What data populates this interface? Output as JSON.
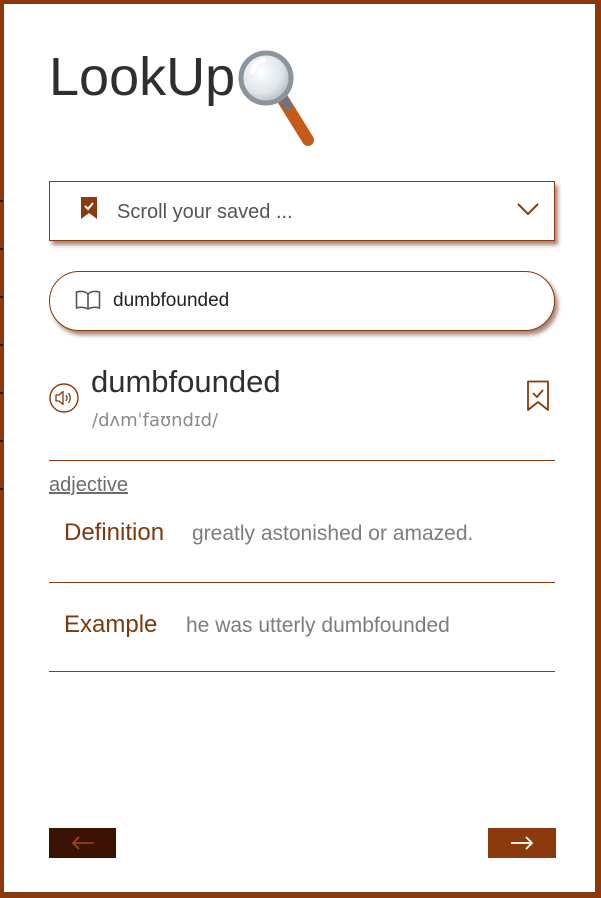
{
  "app": {
    "title": "LookUp",
    "logo_icon": "magnifying-glass-icon"
  },
  "saved_dropdown": {
    "selected_label": "Scroll your saved ...",
    "icon": "bookmark-icon",
    "caret_icon": "chevron-down-icon"
  },
  "search": {
    "value": "dumbfounded",
    "icon": "book-icon"
  },
  "entry": {
    "word": "dumbfounded",
    "phonetic": "/dʌmˈfaʊndɪd/",
    "audio_icon": "speaker-icon",
    "save_icon": "bookmark-check-icon",
    "part_of_speech": "adjective",
    "definition_label": "Definition",
    "definition": "greatly astonished or amazed.",
    "example_label": "Example",
    "example": "he was utterly dumbfounded"
  },
  "nav": {
    "prev_icon": "arrow-left-icon",
    "next_icon": "arrow-right-icon"
  },
  "colors": {
    "accent": "#8a3a0c",
    "dark_accent": "#3a1304",
    "text": "#2f2f2f",
    "muted": "#7d7d7d"
  }
}
